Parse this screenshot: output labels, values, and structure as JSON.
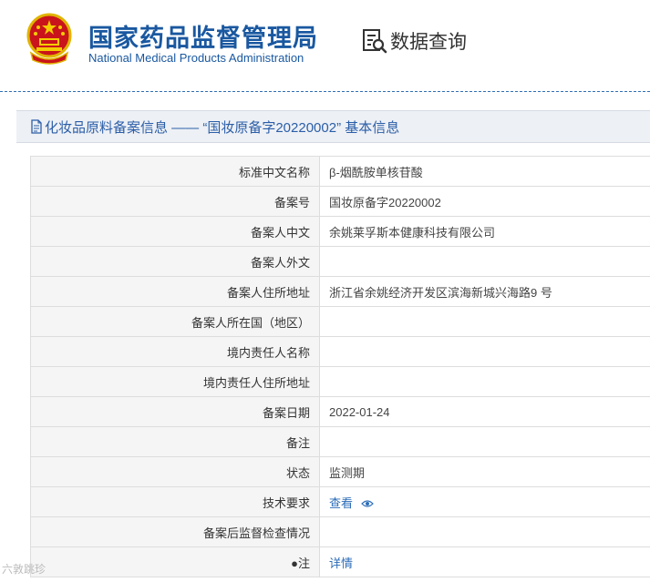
{
  "header": {
    "brand_cn": "国家药品监督管理局",
    "brand_en": "National Medical Products Administration",
    "query_label": "数据查询",
    "brand_color": "#1a58a0"
  },
  "page": {
    "title": "化妆品原料备案信息 —— “国妆原备字20220002” 基本信息"
  },
  "rows": [
    {
      "label": "标准中文名称",
      "value": "β-烟酰胺单核苷酸"
    },
    {
      "label": "备案号",
      "value": "国妆原备字20220002"
    },
    {
      "label": "备案人中文",
      "value": "余姚莱孚斯本健康科技有限公司"
    },
    {
      "label": "备案人外文",
      "value": ""
    },
    {
      "label": "备案人住所地址",
      "value": "浙江省余姚经济开发区滨海新城兴海路9 号"
    },
    {
      "label": "备案人所在国（地区）",
      "value": ""
    },
    {
      "label": "境内责任人名称",
      "value": ""
    },
    {
      "label": "境内责任人住所地址",
      "value": ""
    },
    {
      "label": "备案日期",
      "value": "2022-01-24"
    },
    {
      "label": "备注",
      "value": ""
    },
    {
      "label": "状态",
      "value": "监测期"
    },
    {
      "label": "技术要求",
      "value": "查看",
      "link": true,
      "icon": "eye-icon"
    },
    {
      "label": "备案后监督检查情况",
      "value": ""
    },
    {
      "label": "●注",
      "value": "详情",
      "link": true
    }
  ],
  "watermark": "六敦跳珍"
}
